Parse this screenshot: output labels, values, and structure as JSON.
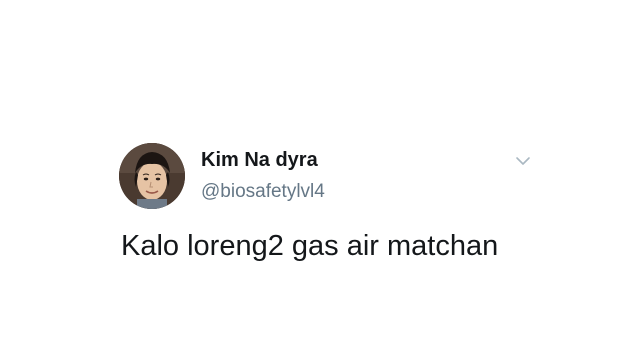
{
  "tweet": {
    "author": {
      "display_name": "Kim Na dyra",
      "handle": "@biosafetylvl4",
      "avatar_icon": "profile-photo"
    },
    "text": "Kalo loreng2 gas air matchan",
    "menu_icon": "chevron-down-icon"
  },
  "colors": {
    "background": "#ffffff",
    "text_primary": "#14171a",
    "text_secondary": "#657786",
    "caret": "#aab8c2"
  }
}
